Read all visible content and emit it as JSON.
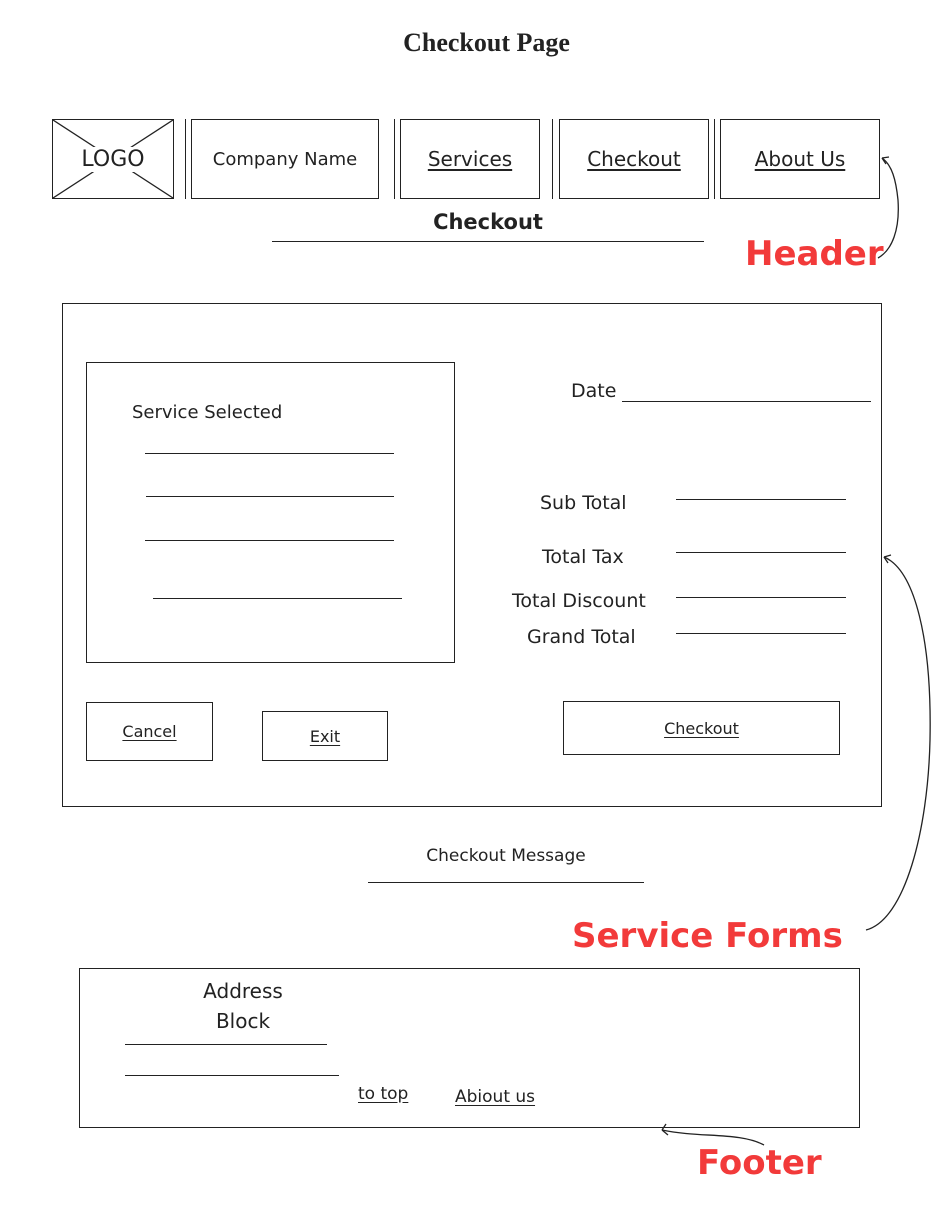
{
  "page_title": "Checkout Page",
  "header": {
    "logo": "LOGO",
    "company_name": "Company Name",
    "nav": [
      "Services",
      "Checkout",
      "About Us"
    ],
    "subtitle": "Checkout"
  },
  "form": {
    "service_selected_label": "Service Selected",
    "date_label": "Date",
    "sub_total_label": "Sub Total",
    "total_tax_label": "Total Tax",
    "total_discount_label": "Total Discount",
    "grand_total_label": "Grand Total",
    "cancel_label": "Cancel",
    "exit_label": "Exit",
    "checkout_label": "Checkout"
  },
  "checkout_message": "Checkout Message",
  "footer": {
    "address_label": "Address Block",
    "to_top_label": "to top",
    "about_us_label": "Abiout us"
  },
  "annotations": {
    "header": "Header",
    "service_forms": "Service Forms",
    "footer": "Footer"
  },
  "colors": {
    "annotation": "#f23a3a",
    "ink": "#222222"
  }
}
